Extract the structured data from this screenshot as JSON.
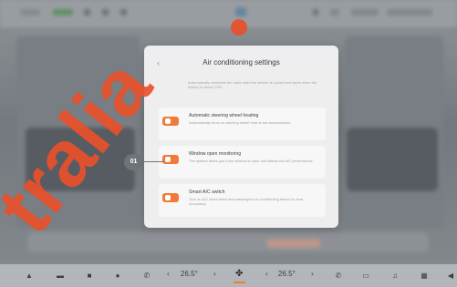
{
  "dialog": {
    "title": "Air conditioning settings",
    "partial_desc": "Automatically ventilates the cabin after the vehicle is locked and starts when the battery is above 20%",
    "items": [
      {
        "title": "Automatic steering wheel heating",
        "desc": "Automatically turns on steering wheel heat at low temperatures"
      },
      {
        "title": "Window open monitoring",
        "desc": "The system alerts you if the window is open and affects the A/C performance"
      },
      {
        "title": "Smart A/C switch",
        "desc": "Turn on A/C when there are passengers on conditioning based on seat occupancy"
      }
    ]
  },
  "callout": {
    "label": "01"
  },
  "dock": {
    "left_temp": "26.5°",
    "right_temp": "26.5°",
    "left_decrease": "‹",
    "left_increase": "›",
    "right_decrease": "‹",
    "right_increase": "›"
  },
  "watermark": {
    "text": "tralia"
  },
  "colors": {
    "accent": "#f07a3a",
    "watermark": "#e8502a"
  }
}
